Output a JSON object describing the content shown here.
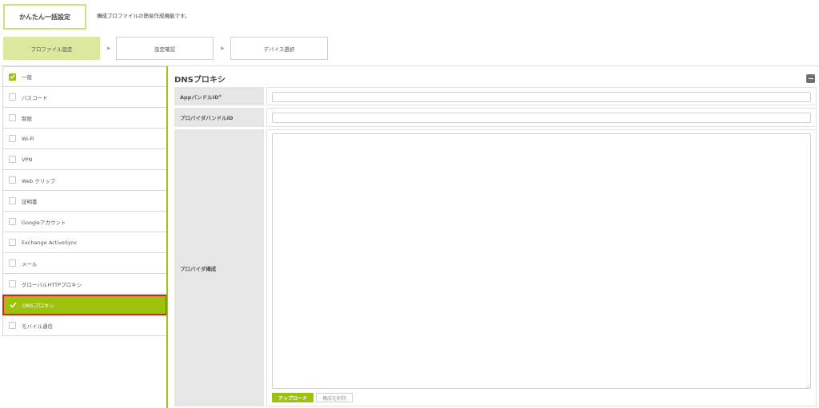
{
  "header": {
    "title": "かんたん一括設定",
    "description": "構成プロファイルの簡易作成機能です。"
  },
  "steps": [
    {
      "label": "プロファイル設定",
      "active": true
    },
    {
      "label": "設定確認",
      "active": false
    },
    {
      "label": "デバイス選択",
      "active": false
    }
  ],
  "step_arrow": "▶",
  "sidebar": {
    "items": [
      {
        "label": "一般",
        "checked": true
      },
      {
        "label": "パスコード",
        "checked": false
      },
      {
        "label": "制限",
        "checked": false
      },
      {
        "label": "Wi-Fi",
        "checked": false
      },
      {
        "label": "VPN",
        "checked": false
      },
      {
        "label": "Web クリップ",
        "checked": false
      },
      {
        "label": "証明書",
        "checked": false
      },
      {
        "label": "Googleアカウント",
        "checked": false
      },
      {
        "label": "Exchange ActiveSync",
        "checked": false
      },
      {
        "label": "メール",
        "checked": false
      },
      {
        "label": "グローバルHTTPプロキシ",
        "checked": false
      },
      {
        "label": "DNSプロキシ",
        "checked": false,
        "active": true
      },
      {
        "label": "モバイル通信",
        "checked": false
      }
    ]
  },
  "main": {
    "title": "DNSプロキシ",
    "fields": {
      "app_bundle_id": {
        "label": "AppバンドルID",
        "required_mark": "*",
        "value": ""
      },
      "provider_bundle_id": {
        "label": "プロバイダバンドルID",
        "value": ""
      },
      "provider_config": {
        "label": "プロバイダ構成",
        "value": ""
      }
    },
    "upload_label": "アップロード",
    "delete_label": "構成を削除"
  },
  "colors": {
    "accent": "#9cc20e",
    "accent_light": "#dbe89e",
    "highlight_border": "#e0201b"
  }
}
